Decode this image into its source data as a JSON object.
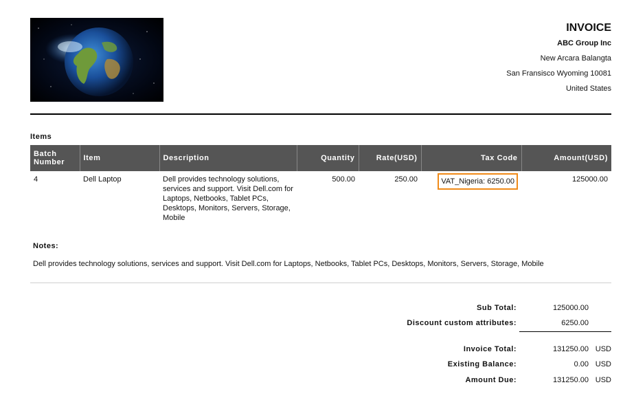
{
  "header": {
    "doc_title": "INVOICE",
    "company_name": "ABC Group Inc",
    "address_line1": "New Arcara Balangta",
    "address_line2": "San Fransisco Wyoming 10081",
    "address_line3": "United States"
  },
  "items_section": {
    "label": "Items",
    "columns": {
      "batch": "Batch Number",
      "item": "Item",
      "description": "Description",
      "quantity": "Quantity",
      "rate": "Rate(USD)",
      "tax_code": "Tax Code",
      "amount": "Amount(USD)"
    },
    "rows": [
      {
        "batch": "4",
        "item": "Dell Laptop",
        "description": "Dell provides technology solutions, services and support. Visit Dell.com for Laptops, Netbooks, Tablet PCs, Desktops, Monitors, Servers, Storage, Mobile",
        "quantity": "500.00",
        "rate": "250.00",
        "tax_code": "VAT_Nigeria: 6250.00",
        "amount": "125000.00"
      }
    ]
  },
  "notes": {
    "label": "Notes:",
    "text": "Dell provides technology solutions, services and support. Visit Dell.com for Laptops, Netbooks, Tablet PCs, Desktops, Monitors, Servers, Storage, Mobile"
  },
  "totals": {
    "sub_total_label": "Sub Total:",
    "sub_total_value": "125000.00",
    "discount_label": "Discount custom attributes:",
    "discount_value": "6250.00",
    "invoice_total_label": "Invoice Total:",
    "invoice_total_value": "131250.00",
    "invoice_total_currency": "USD",
    "existing_balance_label": "Existing Balance:",
    "existing_balance_value": "0.00",
    "existing_balance_currency": "USD",
    "amount_due_label": "Amount Due:",
    "amount_due_value": "131250.00",
    "amount_due_currency": "USD"
  },
  "colors": {
    "table_header_bg": "#555555",
    "highlight_border": "#f08a18"
  },
  "logo": {
    "icon": "earth-globe-icon"
  }
}
